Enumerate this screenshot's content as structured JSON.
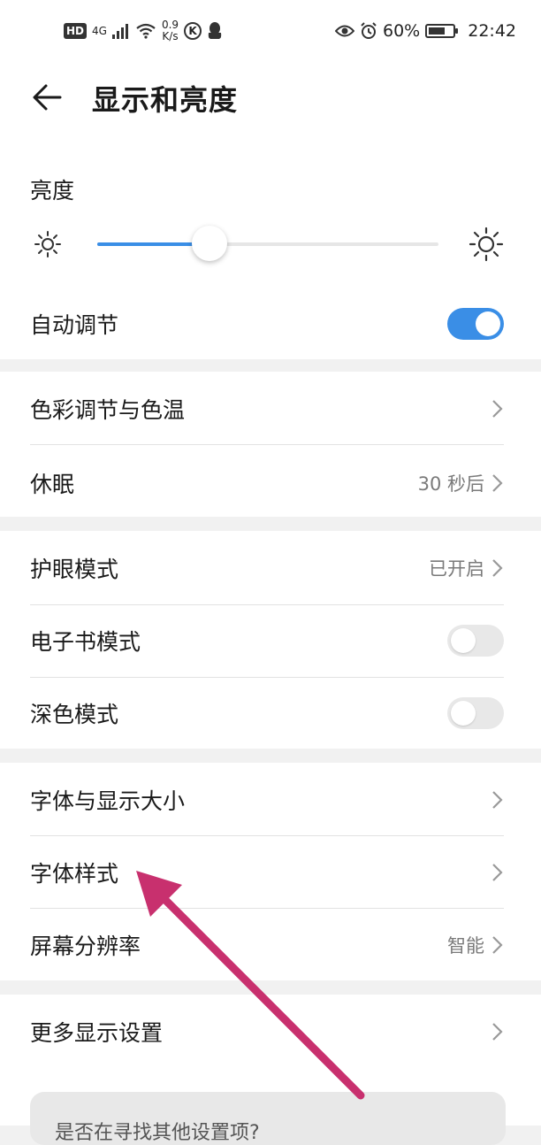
{
  "status_bar": {
    "hd": "HD",
    "network": "4G",
    "speed_value": "0.9",
    "speed_unit": "K/s",
    "k_badge": "K",
    "battery_percent": "60%",
    "time": "22:42",
    "icons": [
      "hd-badge-icon",
      "signal-icon",
      "wifi-icon",
      "k-app-icon",
      "qq-icon",
      "eye-icon",
      "alarm-icon",
      "battery-icon"
    ]
  },
  "header": {
    "title": "显示和亮度",
    "back_icon": "back-arrow-icon"
  },
  "brightness": {
    "label": "亮度",
    "level": 0.33,
    "low_icon": "sun-small-icon",
    "high_icon": "sun-large-icon",
    "auto_label": "自动调节",
    "auto_on": true
  },
  "group1": {
    "color": {
      "label": "色彩调节与色温"
    },
    "sleep": {
      "label": "休眠",
      "value": "30 秒后"
    }
  },
  "group2": {
    "eye": {
      "label": "护眼模式",
      "value": "已开启"
    },
    "ebook": {
      "label": "电子书模式",
      "on": false
    },
    "dark": {
      "label": "深色模式",
      "on": false
    }
  },
  "group3": {
    "font_size": {
      "label": "字体与显示大小"
    },
    "font_style": {
      "label": "字体样式"
    },
    "resolution": {
      "label": "屏幕分辨率",
      "value": "智能"
    }
  },
  "group4": {
    "more": {
      "label": "更多显示设置"
    }
  },
  "hint": {
    "text": "是否在寻找其他设置项?"
  },
  "colors": {
    "accent": "#3a8ee6",
    "annotation_arrow": "#c8306e"
  }
}
